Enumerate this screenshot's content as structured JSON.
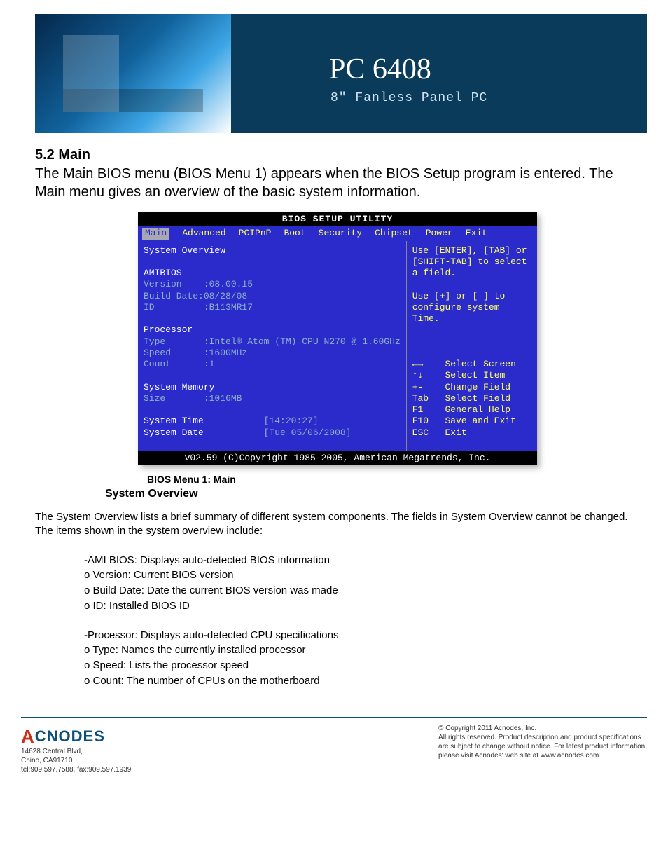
{
  "banner": {
    "title": "PC 6408",
    "subtitle": "8\" Fanless Panel PC"
  },
  "section": {
    "num_title": "5.2  Main",
    "intro": "The Main BIOS menu (BIOS Menu 1) appears when the BIOS Setup program is entered. The Main menu gives an overview of the basic system information."
  },
  "bios": {
    "title": "BIOS SETUP UTILITY",
    "tabs": [
      "Main",
      "Advanced",
      "PCIPnP",
      "Boot",
      "Security",
      "Chipset",
      "Power",
      "Exit"
    ],
    "left": {
      "overview_label": "System Overview",
      "amibios_label": "AMIBIOS",
      "version_label": "Version",
      "version_val": ":08.00.15",
      "build_label": "Build Date",
      "build_val": ":08/28/08",
      "id_label": "ID",
      "id_val": ":B113MR17",
      "proc_label": "Processor",
      "type_label": "Type",
      "type_val": ":Intel® Atom (TM) CPU N270 @ 1.60GHz",
      "speed_label": "Speed",
      "speed_val": ":1600MHz",
      "count_label": "Count",
      "count_val": ":1",
      "mem_label": "System Memory",
      "size_label": "Size",
      "size_val": ":1016MB",
      "time_label": "System Time",
      "time_val": "[14:20:27]",
      "date_label": "System Date",
      "date_val": "[Tue 05/06/2008]"
    },
    "right": {
      "help1": "Use [ENTER], [TAB] or",
      "help2": "[SHIFT-TAB] to select",
      "help3": "a field.",
      "help4": "Use [+] or [-] to",
      "help5": "configure system",
      "help6": "Time.",
      "k1": "←→    Select Screen",
      "k2": "↑↓    Select Item",
      "k3": "+-    Change Field",
      "k4": "Tab   Select Field",
      "k5": "F1    General Help",
      "k6": "F10   Save and Exit",
      "k7": "ESC   Exit"
    },
    "footer": "v02.59 (C)Copyright 1985-2005, American Megatrends, Inc."
  },
  "caption": "BIOS Menu 1: Main",
  "subheader": "System Overview",
  "overview_para": "The System Overview lists a brief summary of different system components. The fields in System Overview cannot be changed. The items shown in the system overview include:",
  "list1": {
    "a": "-AMI BIOS: Displays auto-detected BIOS information",
    "b": "o Version:      Current BIOS version",
    "c": "o Build Date:   Date the current BIOS version was made",
    "d": "o ID:    Installed BIOS ID"
  },
  "list2": {
    "a": "-Processor: Displays auto-detected CPU specifications",
    "b": "o Type:  Names the currently installed processor",
    "c": "o Speed: Lists the processor speed",
    "d": "o Count: The number of CPUs on the motherboard"
  },
  "footer": {
    "logo": "CNODES",
    "addr1": "14628 Central Blvd,",
    "addr2": "Chino, CA91710",
    "addr3": "tel:909.597.7588, fax:909.597.1939",
    "r1": "© Copyright 2011 Acnodes, Inc.",
    "r2": "All rights reserved. Product description and product specifications",
    "r3": "are subject to change without notice. For latest product information,",
    "r4": "please visit Acnodes' web site at www.acnodes.com."
  }
}
